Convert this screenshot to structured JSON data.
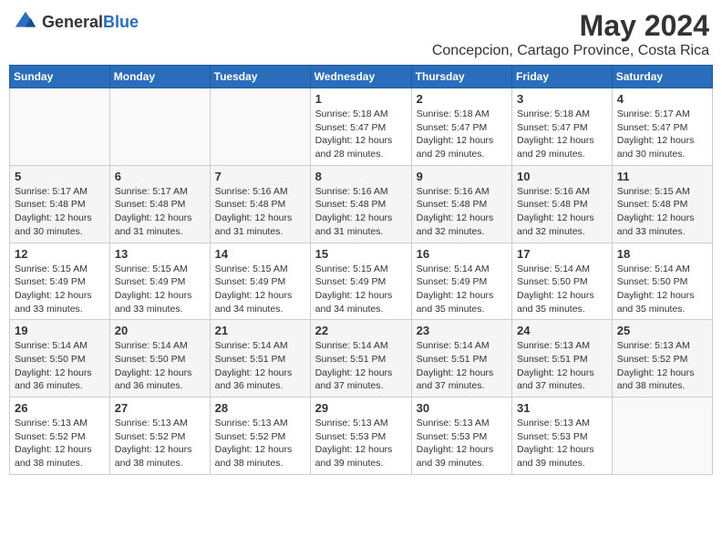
{
  "logo": {
    "general": "General",
    "blue": "Blue"
  },
  "title": {
    "month": "May 2024",
    "location": "Concepcion, Cartago Province, Costa Rica"
  },
  "weekdays": [
    "Sunday",
    "Monday",
    "Tuesday",
    "Wednesday",
    "Thursday",
    "Friday",
    "Saturday"
  ],
  "weeks": [
    [
      {
        "day": "",
        "info": ""
      },
      {
        "day": "",
        "info": ""
      },
      {
        "day": "",
        "info": ""
      },
      {
        "day": "1",
        "info": "Sunrise: 5:18 AM\nSunset: 5:47 PM\nDaylight: 12 hours\nand 28 minutes."
      },
      {
        "day": "2",
        "info": "Sunrise: 5:18 AM\nSunset: 5:47 PM\nDaylight: 12 hours\nand 29 minutes."
      },
      {
        "day": "3",
        "info": "Sunrise: 5:18 AM\nSunset: 5:47 PM\nDaylight: 12 hours\nand 29 minutes."
      },
      {
        "day": "4",
        "info": "Sunrise: 5:17 AM\nSunset: 5:47 PM\nDaylight: 12 hours\nand 30 minutes."
      }
    ],
    [
      {
        "day": "5",
        "info": "Sunrise: 5:17 AM\nSunset: 5:48 PM\nDaylight: 12 hours\nand 30 minutes."
      },
      {
        "day": "6",
        "info": "Sunrise: 5:17 AM\nSunset: 5:48 PM\nDaylight: 12 hours\nand 31 minutes."
      },
      {
        "day": "7",
        "info": "Sunrise: 5:16 AM\nSunset: 5:48 PM\nDaylight: 12 hours\nand 31 minutes."
      },
      {
        "day": "8",
        "info": "Sunrise: 5:16 AM\nSunset: 5:48 PM\nDaylight: 12 hours\nand 31 minutes."
      },
      {
        "day": "9",
        "info": "Sunrise: 5:16 AM\nSunset: 5:48 PM\nDaylight: 12 hours\nand 32 minutes."
      },
      {
        "day": "10",
        "info": "Sunrise: 5:16 AM\nSunset: 5:48 PM\nDaylight: 12 hours\nand 32 minutes."
      },
      {
        "day": "11",
        "info": "Sunrise: 5:15 AM\nSunset: 5:48 PM\nDaylight: 12 hours\nand 33 minutes."
      }
    ],
    [
      {
        "day": "12",
        "info": "Sunrise: 5:15 AM\nSunset: 5:49 PM\nDaylight: 12 hours\nand 33 minutes."
      },
      {
        "day": "13",
        "info": "Sunrise: 5:15 AM\nSunset: 5:49 PM\nDaylight: 12 hours\nand 33 minutes."
      },
      {
        "day": "14",
        "info": "Sunrise: 5:15 AM\nSunset: 5:49 PM\nDaylight: 12 hours\nand 34 minutes."
      },
      {
        "day": "15",
        "info": "Sunrise: 5:15 AM\nSunset: 5:49 PM\nDaylight: 12 hours\nand 34 minutes."
      },
      {
        "day": "16",
        "info": "Sunrise: 5:14 AM\nSunset: 5:49 PM\nDaylight: 12 hours\nand 35 minutes."
      },
      {
        "day": "17",
        "info": "Sunrise: 5:14 AM\nSunset: 5:50 PM\nDaylight: 12 hours\nand 35 minutes."
      },
      {
        "day": "18",
        "info": "Sunrise: 5:14 AM\nSunset: 5:50 PM\nDaylight: 12 hours\nand 35 minutes."
      }
    ],
    [
      {
        "day": "19",
        "info": "Sunrise: 5:14 AM\nSunset: 5:50 PM\nDaylight: 12 hours\nand 36 minutes."
      },
      {
        "day": "20",
        "info": "Sunrise: 5:14 AM\nSunset: 5:50 PM\nDaylight: 12 hours\nand 36 minutes."
      },
      {
        "day": "21",
        "info": "Sunrise: 5:14 AM\nSunset: 5:51 PM\nDaylight: 12 hours\nand 36 minutes."
      },
      {
        "day": "22",
        "info": "Sunrise: 5:14 AM\nSunset: 5:51 PM\nDaylight: 12 hours\nand 37 minutes."
      },
      {
        "day": "23",
        "info": "Sunrise: 5:14 AM\nSunset: 5:51 PM\nDaylight: 12 hours\nand 37 minutes."
      },
      {
        "day": "24",
        "info": "Sunrise: 5:13 AM\nSunset: 5:51 PM\nDaylight: 12 hours\nand 37 minutes."
      },
      {
        "day": "25",
        "info": "Sunrise: 5:13 AM\nSunset: 5:52 PM\nDaylight: 12 hours\nand 38 minutes."
      }
    ],
    [
      {
        "day": "26",
        "info": "Sunrise: 5:13 AM\nSunset: 5:52 PM\nDaylight: 12 hours\nand 38 minutes."
      },
      {
        "day": "27",
        "info": "Sunrise: 5:13 AM\nSunset: 5:52 PM\nDaylight: 12 hours\nand 38 minutes."
      },
      {
        "day": "28",
        "info": "Sunrise: 5:13 AM\nSunset: 5:52 PM\nDaylight: 12 hours\nand 38 minutes."
      },
      {
        "day": "29",
        "info": "Sunrise: 5:13 AM\nSunset: 5:53 PM\nDaylight: 12 hours\nand 39 minutes."
      },
      {
        "day": "30",
        "info": "Sunrise: 5:13 AM\nSunset: 5:53 PM\nDaylight: 12 hours\nand 39 minutes."
      },
      {
        "day": "31",
        "info": "Sunrise: 5:13 AM\nSunset: 5:53 PM\nDaylight: 12 hours\nand 39 minutes."
      },
      {
        "day": "",
        "info": ""
      }
    ]
  ]
}
